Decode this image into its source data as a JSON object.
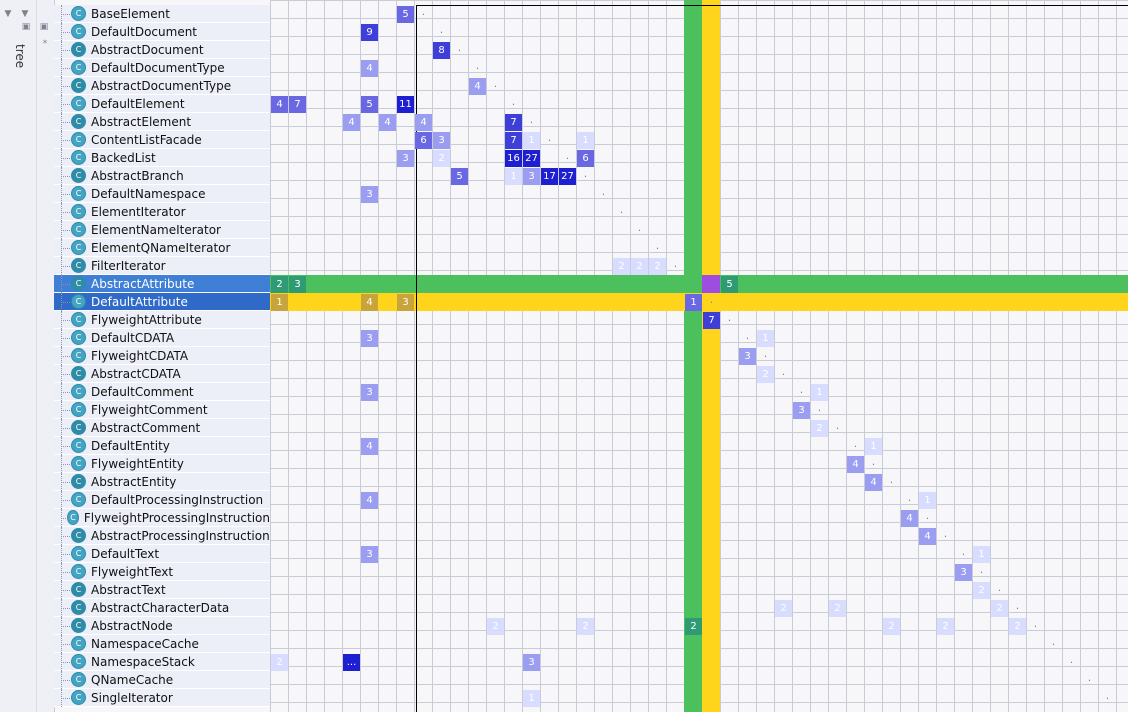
{
  "app": {
    "left_panel": {
      "tabs": [
        {
          "label": "tree"
        }
      ],
      "icons": [
        "collapse-icon",
        "expand-icon",
        "pin-icon",
        "settings-icon"
      ]
    },
    "rows": [
      {
        "label": "BaseElement"
      },
      {
        "label": "DefaultDocument"
      },
      {
        "label": "AbstractDocument"
      },
      {
        "label": "DefaultDocumentType"
      },
      {
        "label": "AbstractDocumentType"
      },
      {
        "label": "DefaultElement"
      },
      {
        "label": "AbstractElement"
      },
      {
        "label": "ContentListFacade"
      },
      {
        "label": "BackedList"
      },
      {
        "label": "AbstractBranch"
      },
      {
        "label": "DefaultNamespace"
      },
      {
        "label": "ElementIterator"
      },
      {
        "label": "ElementNameIterator"
      },
      {
        "label": "ElementQNameIterator"
      },
      {
        "label": "FilterIterator"
      },
      {
        "label": "AbstractAttribute"
      },
      {
        "label": "DefaultAttribute"
      },
      {
        "label": "FlyweightAttribute"
      },
      {
        "label": "DefaultCDATA"
      },
      {
        "label": "FlyweightCDATA"
      },
      {
        "label": "AbstractCDATA"
      },
      {
        "label": "DefaultComment"
      },
      {
        "label": "FlyweightComment"
      },
      {
        "label": "AbstractComment"
      },
      {
        "label": "DefaultEntity"
      },
      {
        "label": "FlyweightEntity"
      },
      {
        "label": "AbstractEntity"
      },
      {
        "label": "DefaultProcessingInstruction"
      },
      {
        "label": "FlyweightProcessingInstruction"
      },
      {
        "label": "AbstractProcessingInstruction"
      },
      {
        "label": "DefaultText"
      },
      {
        "label": "FlyweightText"
      },
      {
        "label": "AbstractText"
      },
      {
        "label": "AbstractCharacterData"
      },
      {
        "label": "AbstractNode"
      },
      {
        "label": "NamespaceCache"
      },
      {
        "label": "NamespaceStack"
      },
      {
        "label": "QNameCache"
      },
      {
        "label": "SingleIterator"
      }
    ],
    "matrix": {
      "selection": {
        "row": "DefaultAttribute",
        "row2": "AbstractAttribute"
      },
      "cells": [
        {
          "r": 0,
          "c": 7,
          "v": "5",
          "k": "d3"
        },
        {
          "r": 1,
          "c": 5,
          "v": "9",
          "k": "d4"
        },
        {
          "r": 2,
          "c": 9,
          "v": "8",
          "k": "d4"
        },
        {
          "r": 3,
          "c": 5,
          "v": "4",
          "k": "d2"
        },
        {
          "r": 4,
          "c": 11,
          "v": "4",
          "k": "d2"
        },
        {
          "r": 5,
          "c": 0,
          "v": "4",
          "k": "d3"
        },
        {
          "r": 5,
          "c": 1,
          "v": "7",
          "k": "d3"
        },
        {
          "r": 5,
          "c": 5,
          "v": "5",
          "k": "d3"
        },
        {
          "r": 5,
          "c": 7,
          "v": "11",
          "k": "d5"
        },
        {
          "r": 6,
          "c": 4,
          "v": "4",
          "k": "d2"
        },
        {
          "r": 6,
          "c": 6,
          "v": "4",
          "k": "d2"
        },
        {
          "r": 6,
          "c": 8,
          "v": "4",
          "k": "d2"
        },
        {
          "r": 6,
          "c": 13,
          "v": "7",
          "k": "d4"
        },
        {
          "r": 7,
          "c": 8,
          "v": "6",
          "k": "d3"
        },
        {
          "r": 7,
          "c": 9,
          "v": "3",
          "k": "d2"
        },
        {
          "r": 7,
          "c": 13,
          "v": "7",
          "k": "d4"
        },
        {
          "r": 7,
          "c": 14,
          "v": "1",
          "k": "d1"
        },
        {
          "r": 7,
          "c": 17,
          "v": "1",
          "k": "d1"
        },
        {
          "r": 8,
          "c": 7,
          "v": "3",
          "k": "d2"
        },
        {
          "r": 8,
          "c": 9,
          "v": "2",
          "k": "d1"
        },
        {
          "r": 8,
          "c": 13,
          "v": "16",
          "k": "d5"
        },
        {
          "r": 8,
          "c": 14,
          "v": "27",
          "k": "d5"
        },
        {
          "r": 8,
          "c": 17,
          "v": "6",
          "k": "d3"
        },
        {
          "r": 9,
          "c": 10,
          "v": "5",
          "k": "d3"
        },
        {
          "r": 9,
          "c": 13,
          "v": "1",
          "k": "d1"
        },
        {
          "r": 9,
          "c": 14,
          "v": "3",
          "k": "d2"
        },
        {
          "r": 9,
          "c": 15,
          "v": "17",
          "k": "d5"
        },
        {
          "r": 9,
          "c": 16,
          "v": "27",
          "k": "d5"
        },
        {
          "r": 10,
          "c": 5,
          "v": "3",
          "k": "d2"
        },
        {
          "r": 14,
          "c": 19,
          "v": "2",
          "k": "d1"
        },
        {
          "r": 14,
          "c": 20,
          "v": "2",
          "k": "d1"
        },
        {
          "r": 14,
          "c": 21,
          "v": "2",
          "k": "d1"
        },
        {
          "r": 15,
          "c": 0,
          "v": "2",
          "k": "dg"
        },
        {
          "r": 15,
          "c": 1,
          "v": "3",
          "k": "dg"
        },
        {
          "r": 15,
          "c": 25,
          "v": "5",
          "k": "dg"
        },
        {
          "r": 16,
          "c": 0,
          "v": "1",
          "k": "dy"
        },
        {
          "r": 16,
          "c": 5,
          "v": "4",
          "k": "dy"
        },
        {
          "r": 16,
          "c": 7,
          "v": "3",
          "k": "dy"
        },
        {
          "r": 16,
          "c": 23,
          "v": "1",
          "k": "d3"
        },
        {
          "r": 17,
          "c": 24,
          "v": "7",
          "k": "d4"
        },
        {
          "r": 18,
          "c": 5,
          "v": "3",
          "k": "d2"
        },
        {
          "r": 18,
          "c": 27,
          "v": "1",
          "k": "d1"
        },
        {
          "r": 19,
          "c": 26,
          "v": "3",
          "k": "d2"
        },
        {
          "r": 20,
          "c": 27,
          "v": "2",
          "k": "d1"
        },
        {
          "r": 21,
          "c": 5,
          "v": "3",
          "k": "d2"
        },
        {
          "r": 21,
          "c": 30,
          "v": "1",
          "k": "d1"
        },
        {
          "r": 22,
          "c": 29,
          "v": "3",
          "k": "d2"
        },
        {
          "r": 23,
          "c": 30,
          "v": "2",
          "k": "d1"
        },
        {
          "r": 24,
          "c": 5,
          "v": "4",
          "k": "d2"
        },
        {
          "r": 24,
          "c": 33,
          "v": "1",
          "k": "d1"
        },
        {
          "r": 25,
          "c": 32,
          "v": "4",
          "k": "d2"
        },
        {
          "r": 26,
          "c": 33,
          "v": "4",
          "k": "d2"
        },
        {
          "r": 27,
          "c": 5,
          "v": "4",
          "k": "d2"
        },
        {
          "r": 27,
          "c": 36,
          "v": "1",
          "k": "d1"
        },
        {
          "r": 28,
          "c": 35,
          "v": "4",
          "k": "d2"
        },
        {
          "r": 29,
          "c": 36,
          "v": "4",
          "k": "d2"
        },
        {
          "r": 30,
          "c": 5,
          "v": "3",
          "k": "d2"
        },
        {
          "r": 30,
          "c": 39,
          "v": "1",
          "k": "d1"
        },
        {
          "r": 31,
          "c": 38,
          "v": "3",
          "k": "d2"
        },
        {
          "r": 32,
          "c": 39,
          "v": "2",
          "k": "d1"
        },
        {
          "r": 33,
          "c": 28,
          "v": "2",
          "k": "d1"
        },
        {
          "r": 33,
          "c": 31,
          "v": "2",
          "k": "d1"
        },
        {
          "r": 33,
          "c": 40,
          "v": "2",
          "k": "d1"
        },
        {
          "r": 34,
          "c": 12,
          "v": "2",
          "k": "d1"
        },
        {
          "r": 34,
          "c": 17,
          "v": "2",
          "k": "d1"
        },
        {
          "r": 34,
          "c": 23,
          "v": "2",
          "k": "dg"
        },
        {
          "r": 34,
          "c": 34,
          "v": "2",
          "k": "d1"
        },
        {
          "r": 34,
          "c": 37,
          "v": "2",
          "k": "d1"
        },
        {
          "r": 34,
          "c": 41,
          "v": "2",
          "k": "d1"
        },
        {
          "r": 36,
          "c": 0,
          "v": "2",
          "k": "d1"
        },
        {
          "r": 36,
          "c": 4,
          "v": "...",
          "k": "d5"
        },
        {
          "r": 36,
          "c": 14,
          "v": "3",
          "k": "d2"
        },
        {
          "r": 38,
          "c": 14,
          "v": "1",
          "k": "d1"
        }
      ]
    }
  }
}
